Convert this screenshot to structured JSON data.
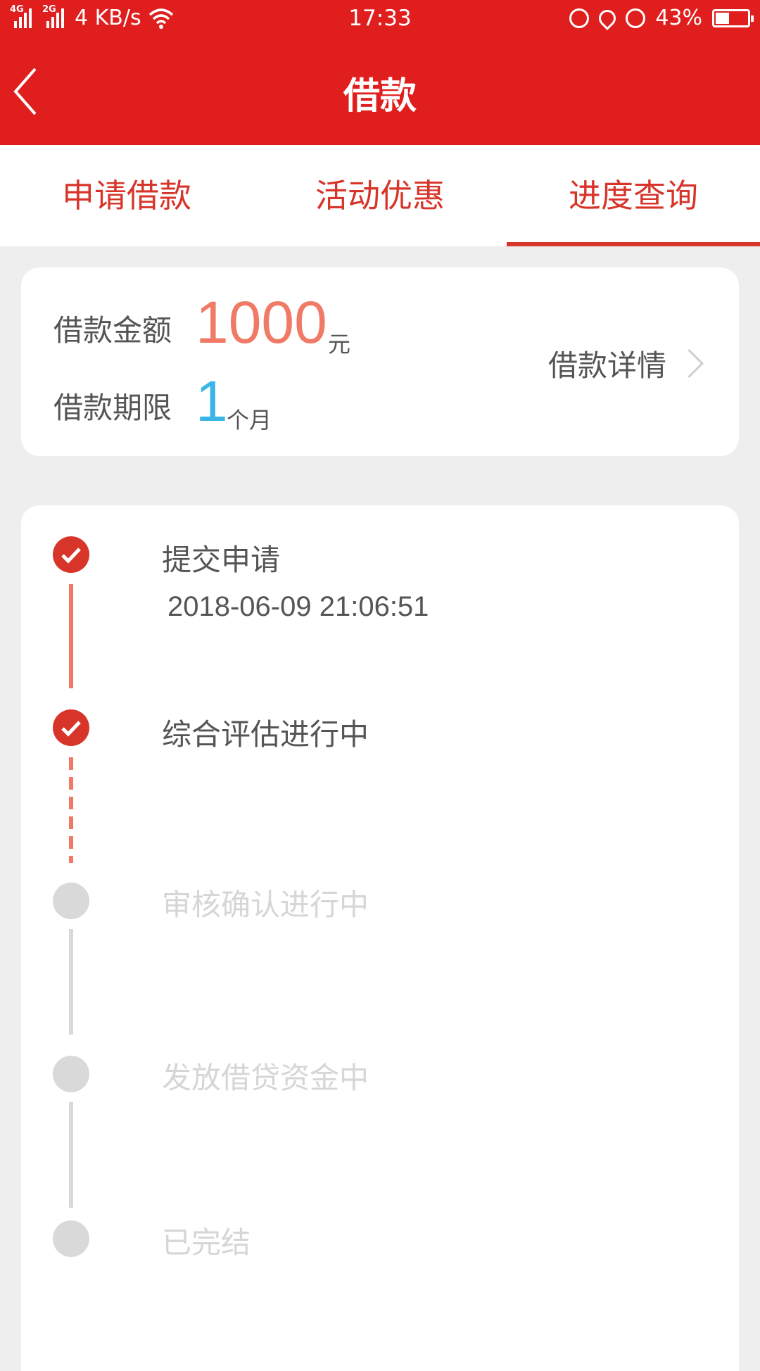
{
  "status_bar": {
    "net1": "4G",
    "net2": "2G",
    "speed": "4 KB/s",
    "time": "17:33",
    "battery": "43%",
    "battery_level": 0.43
  },
  "nav": {
    "title": "借款",
    "back_icon": "chevron-left-icon"
  },
  "tabs": [
    {
      "label": "申请借款",
      "active": false
    },
    {
      "label": "活动优惠",
      "active": false
    },
    {
      "label": "进度查询",
      "active": true
    }
  ],
  "summary": {
    "amount_label": "借款金额",
    "amount_value": "1000",
    "amount_unit": "元",
    "term_label": "借款期限",
    "term_value": "1",
    "term_unit": "个月",
    "detail_link": "借款详情"
  },
  "steps": [
    {
      "label": "提交申请",
      "time": "2018-06-09 21:06:51",
      "status": "done"
    },
    {
      "label": "综合评估进行中",
      "status": "done"
    },
    {
      "label": "审核确认进行中",
      "status": "pending"
    },
    {
      "label": "发放借贷资金中",
      "status": "pending"
    },
    {
      "label": "已完结",
      "status": "pending"
    }
  ],
  "colors": {
    "primary_red": "#e01e1e",
    "tab_red": "#d8352a",
    "amount_orange": "#f07a66",
    "term_blue": "#3bb5e6",
    "pending_grey": "#d9d9d9"
  }
}
